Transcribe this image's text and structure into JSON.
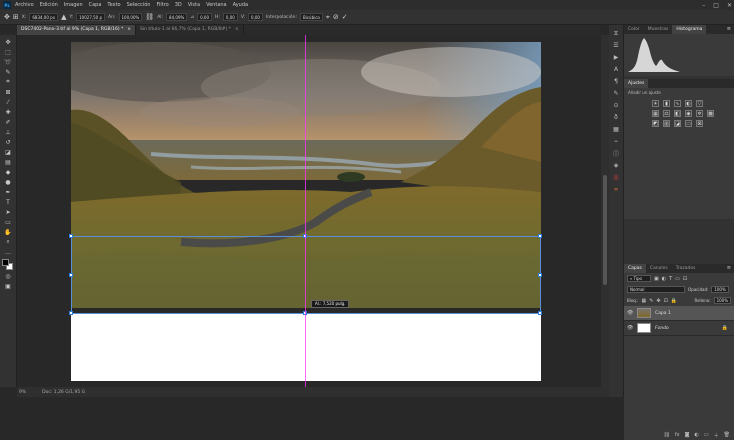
{
  "app": {
    "logo": "Ps"
  },
  "menu": [
    "Archivo",
    "Edición",
    "Imagen",
    "Capa",
    "Texto",
    "Selección",
    "Filtro",
    "3D",
    "Vista",
    "Ventana",
    "Ayuda"
  ],
  "options": {
    "x_label": "X:",
    "x_value": "6834,00 px",
    "y_label": "Y:",
    "y_value": "10027,50 p",
    "w_label": "An:",
    "w_value": "100,00%",
    "h_label": "Al:",
    "h_value": "84,09%",
    "angle_label": "⊿",
    "angle_value": "0,00",
    "hskew_label": "H:",
    "hskew_value": "0,00",
    "vskew_label": "V:",
    "vskew_value": "0,00",
    "interp_label": "Interpolación:",
    "interp_value": "Bicúbica"
  },
  "tabs": [
    {
      "label": "DSC7402-Pano-3.tif al 9% (Capa 1, RGB/16) *",
      "active": true
    },
    {
      "label": "Sin título-1 al 66,7% (Capa 1, RGB/8#) *",
      "active": false
    }
  ],
  "tooltip": "Al.: 7,520 pulg.",
  "status": {
    "zoom": "9%",
    "doc": "Doc: 1,26 G/1,95 G"
  },
  "panels": {
    "top_tabs": [
      "Color",
      "Muestras",
      "Histograma"
    ],
    "adjust_tab": "Ajustes",
    "adjust_subtitle": "Añadir un ajuste",
    "layers_tabs": [
      "Capas",
      "Canales",
      "Trazados"
    ],
    "blend_mode": "Normal",
    "opacity_label": "Opacidad:",
    "opacity_value": "100%",
    "lock_label": "Bloq.:",
    "fill_label": "Relleno:",
    "fill_value": "100%",
    "layers": [
      {
        "name": "Capa 1",
        "selected": true
      },
      {
        "name": "Fondo",
        "selected": false
      }
    ]
  }
}
